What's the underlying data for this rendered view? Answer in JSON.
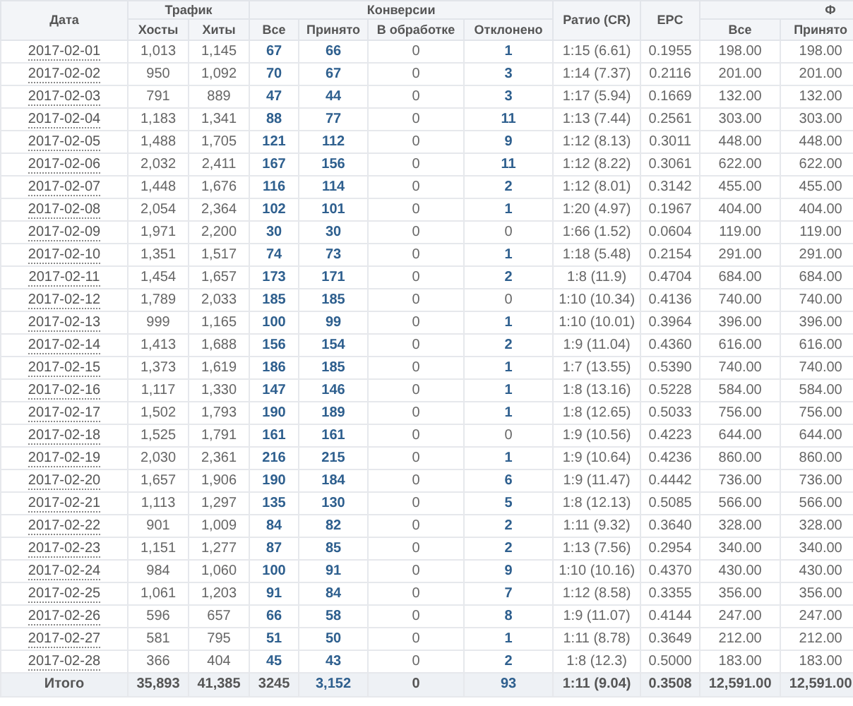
{
  "table": {
    "header": [
      {
        "label": "Дата"
      },
      {
        "label": "Трафик",
        "columns": [
          "Хосты",
          "Хиты"
        ]
      },
      {
        "label": "Конверсии",
        "columns": [
          "Все",
          "Принято",
          "В обработке",
          "Отклонено"
        ]
      },
      {
        "label": "Ратио (CR)"
      },
      {
        "label": "EPC"
      },
      {
        "label": "Ф",
        "columns": [
          "Все",
          "Принято"
        ]
      }
    ],
    "rows": [
      [
        {
          "t": "2017-02-01",
          "link": true
        },
        {
          "t": "1,013",
          "link": false
        },
        {
          "t": "1,145",
          "link": false
        },
        {
          "t": "67",
          "link": true
        },
        {
          "t": "66",
          "link": true
        },
        {
          "t": "0",
          "link": false
        },
        {
          "t": "1",
          "link": true
        },
        {
          "t": "1:15 (6.61)",
          "link": false
        },
        {
          "t": "0.1955",
          "link": false
        },
        {
          "t": "198.00",
          "link": false
        },
        {
          "t": "198.00",
          "link": false
        }
      ],
      [
        {
          "t": "2017-02-02",
          "link": true
        },
        {
          "t": "950",
          "link": false
        },
        {
          "t": "1,092",
          "link": false
        },
        {
          "t": "70",
          "link": true
        },
        {
          "t": "67",
          "link": true
        },
        {
          "t": "0",
          "link": false
        },
        {
          "t": "3",
          "link": true
        },
        {
          "t": "1:14 (7.37)",
          "link": false
        },
        {
          "t": "0.2116",
          "link": false
        },
        {
          "t": "201.00",
          "link": false
        },
        {
          "t": "201.00",
          "link": false
        }
      ],
      [
        {
          "t": "2017-02-03",
          "link": true
        },
        {
          "t": "791",
          "link": false
        },
        {
          "t": "889",
          "link": false
        },
        {
          "t": "47",
          "link": true
        },
        {
          "t": "44",
          "link": true
        },
        {
          "t": "0",
          "link": false
        },
        {
          "t": "3",
          "link": true
        },
        {
          "t": "1:17 (5.94)",
          "link": false
        },
        {
          "t": "0.1669",
          "link": false
        },
        {
          "t": "132.00",
          "link": false
        },
        {
          "t": "132.00",
          "link": false
        }
      ],
      [
        {
          "t": "2017-02-04",
          "link": true
        },
        {
          "t": "1,183",
          "link": false
        },
        {
          "t": "1,341",
          "link": false
        },
        {
          "t": "88",
          "link": true
        },
        {
          "t": "77",
          "link": true
        },
        {
          "t": "0",
          "link": false
        },
        {
          "t": "11",
          "link": true
        },
        {
          "t": "1:13 (7.44)",
          "link": false
        },
        {
          "t": "0.2561",
          "link": false
        },
        {
          "t": "303.00",
          "link": false
        },
        {
          "t": "303.00",
          "link": false
        }
      ],
      [
        {
          "t": "2017-02-05",
          "link": true
        },
        {
          "t": "1,488",
          "link": false
        },
        {
          "t": "1,705",
          "link": false
        },
        {
          "t": "121",
          "link": true
        },
        {
          "t": "112",
          "link": true
        },
        {
          "t": "0",
          "link": false
        },
        {
          "t": "9",
          "link": true
        },
        {
          "t": "1:12 (8.13)",
          "link": false
        },
        {
          "t": "0.3011",
          "link": false
        },
        {
          "t": "448.00",
          "link": false
        },
        {
          "t": "448.00",
          "link": false
        }
      ],
      [
        {
          "t": "2017-02-06",
          "link": true
        },
        {
          "t": "2,032",
          "link": false
        },
        {
          "t": "2,411",
          "link": false
        },
        {
          "t": "167",
          "link": true
        },
        {
          "t": "156",
          "link": true
        },
        {
          "t": "0",
          "link": false
        },
        {
          "t": "11",
          "link": true
        },
        {
          "t": "1:12 (8.22)",
          "link": false
        },
        {
          "t": "0.3061",
          "link": false
        },
        {
          "t": "622.00",
          "link": false
        },
        {
          "t": "622.00",
          "link": false
        }
      ],
      [
        {
          "t": "2017-02-07",
          "link": true
        },
        {
          "t": "1,448",
          "link": false
        },
        {
          "t": "1,676",
          "link": false
        },
        {
          "t": "116",
          "link": true
        },
        {
          "t": "114",
          "link": true
        },
        {
          "t": "0",
          "link": false
        },
        {
          "t": "2",
          "link": true
        },
        {
          "t": "1:12 (8.01)",
          "link": false
        },
        {
          "t": "0.3142",
          "link": false
        },
        {
          "t": "455.00",
          "link": false
        },
        {
          "t": "455.00",
          "link": false
        }
      ],
      [
        {
          "t": "2017-02-08",
          "link": true
        },
        {
          "t": "2,054",
          "link": false
        },
        {
          "t": "2,364",
          "link": false
        },
        {
          "t": "102",
          "link": true
        },
        {
          "t": "101",
          "link": true
        },
        {
          "t": "0",
          "link": false
        },
        {
          "t": "1",
          "link": true
        },
        {
          "t": "1:20 (4.97)",
          "link": false
        },
        {
          "t": "0.1967",
          "link": false
        },
        {
          "t": "404.00",
          "link": false
        },
        {
          "t": "404.00",
          "link": false
        }
      ],
      [
        {
          "t": "2017-02-09",
          "link": true
        },
        {
          "t": "1,971",
          "link": false
        },
        {
          "t": "2,200",
          "link": false
        },
        {
          "t": "30",
          "link": true
        },
        {
          "t": "30",
          "link": true
        },
        {
          "t": "0",
          "link": false
        },
        {
          "t": "0",
          "link": false
        },
        {
          "t": "1:66 (1.52)",
          "link": false
        },
        {
          "t": "0.0604",
          "link": false
        },
        {
          "t": "119.00",
          "link": false
        },
        {
          "t": "119.00",
          "link": false
        }
      ],
      [
        {
          "t": "2017-02-10",
          "link": true
        },
        {
          "t": "1,351",
          "link": false
        },
        {
          "t": "1,517",
          "link": false
        },
        {
          "t": "74",
          "link": true
        },
        {
          "t": "73",
          "link": true
        },
        {
          "t": "0",
          "link": false
        },
        {
          "t": "1",
          "link": true
        },
        {
          "t": "1:18 (5.48)",
          "link": false
        },
        {
          "t": "0.2154",
          "link": false
        },
        {
          "t": "291.00",
          "link": false
        },
        {
          "t": "291.00",
          "link": false
        }
      ],
      [
        {
          "t": "2017-02-11",
          "link": true
        },
        {
          "t": "1,454",
          "link": false
        },
        {
          "t": "1,657",
          "link": false
        },
        {
          "t": "173",
          "link": true
        },
        {
          "t": "171",
          "link": true
        },
        {
          "t": "0",
          "link": false
        },
        {
          "t": "2",
          "link": true
        },
        {
          "t": "1:8 (11.9)",
          "link": false
        },
        {
          "t": "0.4704",
          "link": false
        },
        {
          "t": "684.00",
          "link": false
        },
        {
          "t": "684.00",
          "link": false
        }
      ],
      [
        {
          "t": "2017-02-12",
          "link": true
        },
        {
          "t": "1,789",
          "link": false
        },
        {
          "t": "2,033",
          "link": false
        },
        {
          "t": "185",
          "link": true
        },
        {
          "t": "185",
          "link": true
        },
        {
          "t": "0",
          "link": false
        },
        {
          "t": "0",
          "link": false
        },
        {
          "t": "1:10 (10.34)",
          "link": false
        },
        {
          "t": "0.4136",
          "link": false
        },
        {
          "t": "740.00",
          "link": false
        },
        {
          "t": "740.00",
          "link": false
        }
      ],
      [
        {
          "t": "2017-02-13",
          "link": true
        },
        {
          "t": "999",
          "link": false
        },
        {
          "t": "1,165",
          "link": false
        },
        {
          "t": "100",
          "link": true
        },
        {
          "t": "99",
          "link": true
        },
        {
          "t": "0",
          "link": false
        },
        {
          "t": "1",
          "link": true
        },
        {
          "t": "1:10 (10.01)",
          "link": false
        },
        {
          "t": "0.3964",
          "link": false
        },
        {
          "t": "396.00",
          "link": false
        },
        {
          "t": "396.00",
          "link": false
        }
      ],
      [
        {
          "t": "2017-02-14",
          "link": true
        },
        {
          "t": "1,413",
          "link": false
        },
        {
          "t": "1,688",
          "link": false
        },
        {
          "t": "156",
          "link": true
        },
        {
          "t": "154",
          "link": true
        },
        {
          "t": "0",
          "link": false
        },
        {
          "t": "2",
          "link": true
        },
        {
          "t": "1:9 (11.04)",
          "link": false
        },
        {
          "t": "0.4360",
          "link": false
        },
        {
          "t": "616.00",
          "link": false
        },
        {
          "t": "616.00",
          "link": false
        }
      ],
      [
        {
          "t": "2017-02-15",
          "link": true
        },
        {
          "t": "1,373",
          "link": false
        },
        {
          "t": "1,619",
          "link": false
        },
        {
          "t": "186",
          "link": true
        },
        {
          "t": "185",
          "link": true
        },
        {
          "t": "0",
          "link": false
        },
        {
          "t": "1",
          "link": true
        },
        {
          "t": "1:7 (13.55)",
          "link": false
        },
        {
          "t": "0.5390",
          "link": false
        },
        {
          "t": "740.00",
          "link": false
        },
        {
          "t": "740.00",
          "link": false
        }
      ],
      [
        {
          "t": "2017-02-16",
          "link": true
        },
        {
          "t": "1,117",
          "link": false
        },
        {
          "t": "1,330",
          "link": false
        },
        {
          "t": "147",
          "link": true
        },
        {
          "t": "146",
          "link": true
        },
        {
          "t": "0",
          "link": false
        },
        {
          "t": "1",
          "link": true
        },
        {
          "t": "1:8 (13.16)",
          "link": false
        },
        {
          "t": "0.5228",
          "link": false
        },
        {
          "t": "584.00",
          "link": false
        },
        {
          "t": "584.00",
          "link": false
        }
      ],
      [
        {
          "t": "2017-02-17",
          "link": true
        },
        {
          "t": "1,502",
          "link": false
        },
        {
          "t": "1,793",
          "link": false
        },
        {
          "t": "190",
          "link": true
        },
        {
          "t": "189",
          "link": true
        },
        {
          "t": "0",
          "link": false
        },
        {
          "t": "1",
          "link": true
        },
        {
          "t": "1:8 (12.65)",
          "link": false
        },
        {
          "t": "0.5033",
          "link": false
        },
        {
          "t": "756.00",
          "link": false
        },
        {
          "t": "756.00",
          "link": false
        }
      ],
      [
        {
          "t": "2017-02-18",
          "link": true
        },
        {
          "t": "1,525",
          "link": false
        },
        {
          "t": "1,791",
          "link": false
        },
        {
          "t": "161",
          "link": true
        },
        {
          "t": "161",
          "link": true
        },
        {
          "t": "0",
          "link": false
        },
        {
          "t": "0",
          "link": false
        },
        {
          "t": "1:9 (10.56)",
          "link": false
        },
        {
          "t": "0.4223",
          "link": false
        },
        {
          "t": "644.00",
          "link": false
        },
        {
          "t": "644.00",
          "link": false
        }
      ],
      [
        {
          "t": "2017-02-19",
          "link": true
        },
        {
          "t": "2,030",
          "link": false
        },
        {
          "t": "2,361",
          "link": false
        },
        {
          "t": "216",
          "link": true
        },
        {
          "t": "215",
          "link": true
        },
        {
          "t": "0",
          "link": false
        },
        {
          "t": "1",
          "link": true
        },
        {
          "t": "1:9 (10.64)",
          "link": false
        },
        {
          "t": "0.4236",
          "link": false
        },
        {
          "t": "860.00",
          "link": false
        },
        {
          "t": "860.00",
          "link": false
        }
      ],
      [
        {
          "t": "2017-02-20",
          "link": true
        },
        {
          "t": "1,657",
          "link": false
        },
        {
          "t": "1,906",
          "link": false
        },
        {
          "t": "190",
          "link": true
        },
        {
          "t": "184",
          "link": true
        },
        {
          "t": "0",
          "link": false
        },
        {
          "t": "6",
          "link": true
        },
        {
          "t": "1:9 (11.47)",
          "link": false
        },
        {
          "t": "0.4442",
          "link": false
        },
        {
          "t": "736.00",
          "link": false
        },
        {
          "t": "736.00",
          "link": false
        }
      ],
      [
        {
          "t": "2017-02-21",
          "link": true
        },
        {
          "t": "1,113",
          "link": false
        },
        {
          "t": "1,297",
          "link": false
        },
        {
          "t": "135",
          "link": true
        },
        {
          "t": "130",
          "link": true
        },
        {
          "t": "0",
          "link": false
        },
        {
          "t": "5",
          "link": true
        },
        {
          "t": "1:8 (12.13)",
          "link": false
        },
        {
          "t": "0.5085",
          "link": false
        },
        {
          "t": "566.00",
          "link": false
        },
        {
          "t": "566.00",
          "link": false
        }
      ],
      [
        {
          "t": "2017-02-22",
          "link": true
        },
        {
          "t": "901",
          "link": false
        },
        {
          "t": "1,009",
          "link": false
        },
        {
          "t": "84",
          "link": true
        },
        {
          "t": "82",
          "link": true
        },
        {
          "t": "0",
          "link": false
        },
        {
          "t": "2",
          "link": true
        },
        {
          "t": "1:11 (9.32)",
          "link": false
        },
        {
          "t": "0.3640",
          "link": false
        },
        {
          "t": "328.00",
          "link": false
        },
        {
          "t": "328.00",
          "link": false
        }
      ],
      [
        {
          "t": "2017-02-23",
          "link": true
        },
        {
          "t": "1,151",
          "link": false
        },
        {
          "t": "1,277",
          "link": false
        },
        {
          "t": "87",
          "link": true
        },
        {
          "t": "85",
          "link": true
        },
        {
          "t": "0",
          "link": false
        },
        {
          "t": "2",
          "link": true
        },
        {
          "t": "1:13 (7.56)",
          "link": false
        },
        {
          "t": "0.2954",
          "link": false
        },
        {
          "t": "340.00",
          "link": false
        },
        {
          "t": "340.00",
          "link": false
        }
      ],
      [
        {
          "t": "2017-02-24",
          "link": true
        },
        {
          "t": "984",
          "link": false
        },
        {
          "t": "1,060",
          "link": false
        },
        {
          "t": "100",
          "link": true
        },
        {
          "t": "91",
          "link": true
        },
        {
          "t": "0",
          "link": false
        },
        {
          "t": "9",
          "link": true
        },
        {
          "t": "1:10 (10.16)",
          "link": false
        },
        {
          "t": "0.4370",
          "link": false
        },
        {
          "t": "430.00",
          "link": false
        },
        {
          "t": "430.00",
          "link": false
        }
      ],
      [
        {
          "t": "2017-02-25",
          "link": true
        },
        {
          "t": "1,061",
          "link": false
        },
        {
          "t": "1,203",
          "link": false
        },
        {
          "t": "91",
          "link": true
        },
        {
          "t": "84",
          "link": true
        },
        {
          "t": "0",
          "link": false
        },
        {
          "t": "7",
          "link": true
        },
        {
          "t": "1:12 (8.58)",
          "link": false
        },
        {
          "t": "0.3355",
          "link": false
        },
        {
          "t": "356.00",
          "link": false
        },
        {
          "t": "356.00",
          "link": false
        }
      ],
      [
        {
          "t": "2017-02-26",
          "link": true
        },
        {
          "t": "596",
          "link": false
        },
        {
          "t": "657",
          "link": false
        },
        {
          "t": "66",
          "link": true
        },
        {
          "t": "58",
          "link": true
        },
        {
          "t": "0",
          "link": false
        },
        {
          "t": "8",
          "link": true
        },
        {
          "t": "1:9 (11.07)",
          "link": false
        },
        {
          "t": "0.4144",
          "link": false
        },
        {
          "t": "247.00",
          "link": false
        },
        {
          "t": "247.00",
          "link": false
        }
      ],
      [
        {
          "t": "2017-02-27",
          "link": true
        },
        {
          "t": "581",
          "link": false
        },
        {
          "t": "795",
          "link": false
        },
        {
          "t": "51",
          "link": true
        },
        {
          "t": "50",
          "link": true
        },
        {
          "t": "0",
          "link": false
        },
        {
          "t": "1",
          "link": true
        },
        {
          "t": "1:11 (8.78)",
          "link": false
        },
        {
          "t": "0.3649",
          "link": false
        },
        {
          "t": "212.00",
          "link": false
        },
        {
          "t": "212.00",
          "link": false
        }
      ],
      [
        {
          "t": "2017-02-28",
          "link": true
        },
        {
          "t": "366",
          "link": false
        },
        {
          "t": "404",
          "link": false
        },
        {
          "t": "45",
          "link": true
        },
        {
          "t": "43",
          "link": true
        },
        {
          "t": "0",
          "link": false
        },
        {
          "t": "2",
          "link": true
        },
        {
          "t": "1:8 (12.3)",
          "link": false
        },
        {
          "t": "0.5000",
          "link": false
        },
        {
          "t": "183.00",
          "link": false
        },
        {
          "t": "183.00",
          "link": false
        }
      ]
    ],
    "totals": [
      {
        "t": "Итого",
        "link": false
      },
      {
        "t": "35,893",
        "link": false
      },
      {
        "t": "41,385",
        "link": false
      },
      {
        "t": "3245",
        "link": false
      },
      {
        "t": "3,152",
        "link": true
      },
      {
        "t": "0",
        "link": false
      },
      {
        "t": "93",
        "link": true
      },
      {
        "t": "1:11 (9.04)",
        "link": false
      },
      {
        "t": "0.3508",
        "link": false
      },
      {
        "t": "12,591.00",
        "link": false
      },
      {
        "t": "12,591.00",
        "link": false
      }
    ]
  }
}
